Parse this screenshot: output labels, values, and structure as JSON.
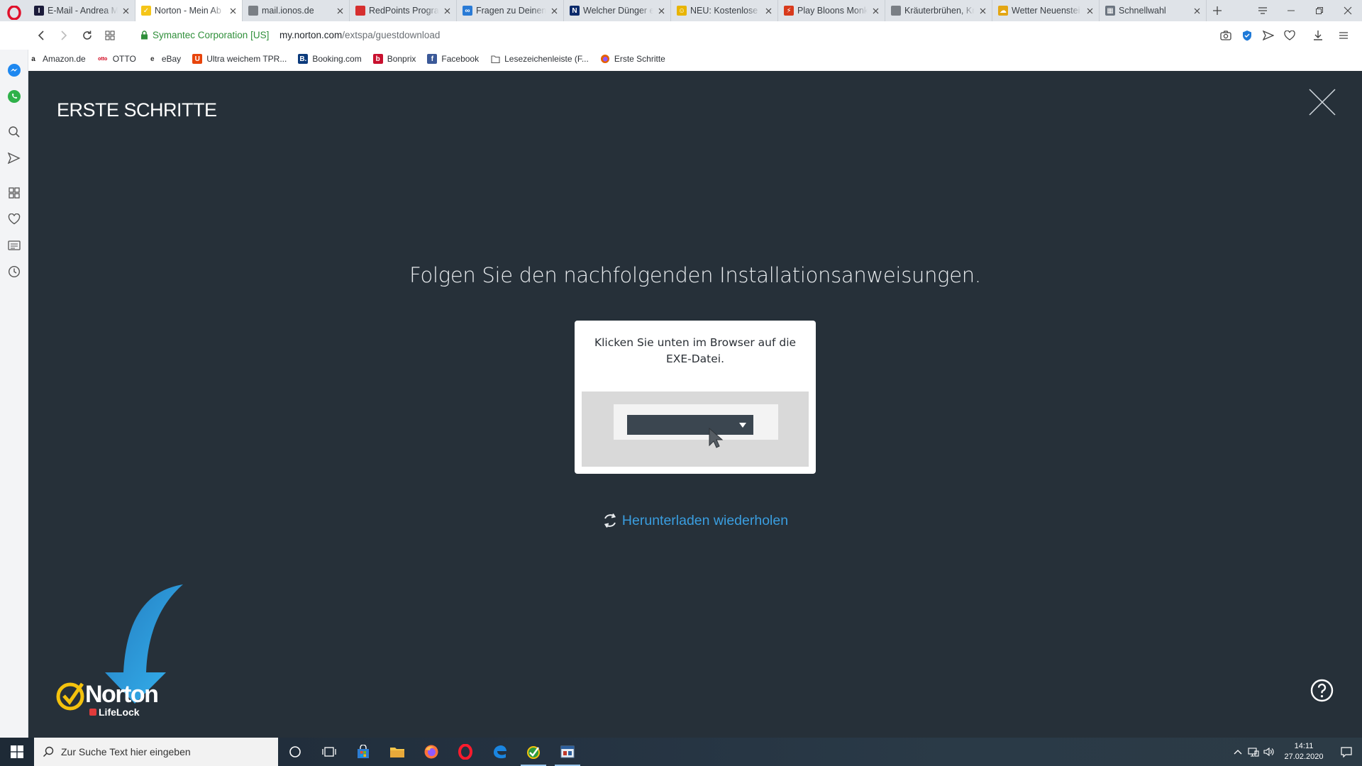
{
  "browser": {
    "tabs": [
      {
        "title": "E-Mail - Andrea M",
        "favicon_text": "I",
        "favicon_color": "#1b1b3a",
        "active": false
      },
      {
        "title": "Norton - Mein Ab",
        "favicon_text": "✓",
        "favicon_color": "#f5c518",
        "active": true
      },
      {
        "title": "mail.ionos.de",
        "favicon_text": "",
        "favicon_color": "#7a7f85",
        "active": false
      },
      {
        "title": "RedPoints Progran",
        "favicon_text": "",
        "favicon_color": "#d62f2f",
        "active": false
      },
      {
        "title": "Fragen zu Deinen",
        "favicon_text": "∞",
        "favicon_color": "#2a7bd6",
        "active": false
      },
      {
        "title": "Welcher Dünger e",
        "favicon_text": "N",
        "favicon_color": "#0b2a6b",
        "active": false
      },
      {
        "title": "NEU: Kostenlose C",
        "favicon_text": "☺",
        "favicon_color": "#e8b400",
        "active": false
      },
      {
        "title": "Play Bloons Monk",
        "favicon_text": "⚡",
        "favicon_color": "#d83a1c",
        "active": false
      },
      {
        "title": "Kräuterbrühen, Kr",
        "favicon_text": "",
        "favicon_color": "#7a7f85",
        "active": false
      },
      {
        "title": "Wetter Neuenstei",
        "favicon_text": "☁",
        "favicon_color": "#e3a613",
        "active": false
      },
      {
        "title": "Schnellwahl",
        "favicon_text": "▦",
        "favicon_color": "#6c7580",
        "active": false
      }
    ],
    "address": {
      "security_label": "Symantec Corporation [US]",
      "url_host": "my.norton.com",
      "url_path": "/extspa/guestdownload"
    },
    "bookmarks": [
      {
        "label": "Amazon.de",
        "icon": "a",
        "color": "#222222"
      },
      {
        "label": "OTTO",
        "icon": "otto",
        "color": "#d0021b"
      },
      {
        "label": "eBay",
        "icon": "e",
        "color": "#333333"
      },
      {
        "label": "Ultra weichem TPR...",
        "icon": "U",
        "color": "#e8440b"
      },
      {
        "label": "Booking.com",
        "icon": "B.",
        "color": "#0c3b7c"
      },
      {
        "label": "Bonprix",
        "icon": "b",
        "color": "#c8102e"
      },
      {
        "label": "Facebook",
        "icon": "f",
        "color": "#3b5998"
      },
      {
        "label": "Lesezeichenleiste (F...",
        "icon": "folder-icon",
        "color": "#555555"
      },
      {
        "label": "Erste Schritte",
        "icon": "firefox-icon",
        "color": "#e66000"
      }
    ]
  },
  "page": {
    "title": "ERSTE SCHRITTE",
    "instruction": "Folgen Sie den nachfolgenden Installationsanweisungen.",
    "card_text": "Klicken Sie unten im Browser auf die EXE-Datei.",
    "retry_label": "Herunterladen wiederholen",
    "logo_name": "Norton",
    "logo_sub": "LifeLock",
    "accent_color": "#3a9ee0",
    "background_color": "#263039"
  },
  "taskbar": {
    "search_placeholder": "Zur Suche Text hier eingeben",
    "time": "14:11",
    "date": "27.02.2020"
  }
}
